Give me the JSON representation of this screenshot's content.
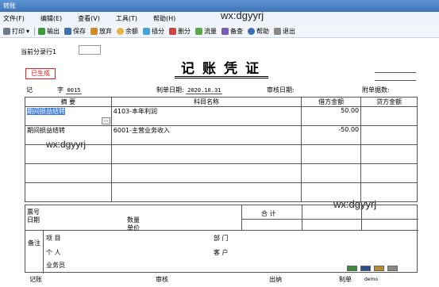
{
  "window": {
    "title": "转账"
  },
  "watermark": "wx:dgyyrj",
  "menu": [
    "文件(F)",
    "编辑(E)",
    "查看(V)",
    "工具(T)",
    "帮助(H)"
  ],
  "toolbar": {
    "print": "打印",
    "print_arrow": "▾",
    "export": "输出",
    "save": "保存",
    "discard": "放弃",
    "balance": "余额",
    "insert": "插分",
    "delete": "删分",
    "flow": "流量",
    "memo": "备查",
    "help": "帮助",
    "exit": "退出"
  },
  "current_row": {
    "label": "当前分录行1",
    "value": ""
  },
  "status_stamp": "已生成",
  "voucher": {
    "title": "记账凭证",
    "type_label": "记",
    "number_label": "字",
    "number": "0015",
    "date_label": "制单日期:",
    "date": "2020.10.31",
    "audit_date_label": "审核日期:",
    "attachments_label": "附单据数:",
    "attachments": ""
  },
  "table": {
    "headers": [
      "摘 要",
      "科目名称",
      "借方金额",
      "贷方金额"
    ],
    "rows": [
      {
        "summary": "期间损益结转",
        "account": "4103-本年利润",
        "debit": "50.00",
        "credit": ""
      },
      {
        "summary": "期间损益结转",
        "account": "6001-主营业务收入",
        "debit": "-50.00",
        "credit": ""
      },
      {
        "summary": "",
        "account": "",
        "debit": "",
        "credit": ""
      },
      {
        "summary": "",
        "account": "",
        "debit": "",
        "credit": ""
      },
      {
        "summary": "",
        "account": "",
        "debit": "",
        "credit": ""
      }
    ],
    "ellipsis": "..."
  },
  "lower": {
    "ticket_no": "票号",
    "date": "日期",
    "quantity": "数量",
    "unit_price": "单价",
    "total": "合 计",
    "remark": "备注",
    "item": "项  目",
    "department": "部  门",
    "personal": "个  人",
    "customer": "客  户",
    "salesman": "业务员"
  },
  "footer": {
    "bookkeeping": "记账",
    "audit": "审核",
    "cashier": "出纳",
    "maker": "制单",
    "maker_name": "demo"
  }
}
